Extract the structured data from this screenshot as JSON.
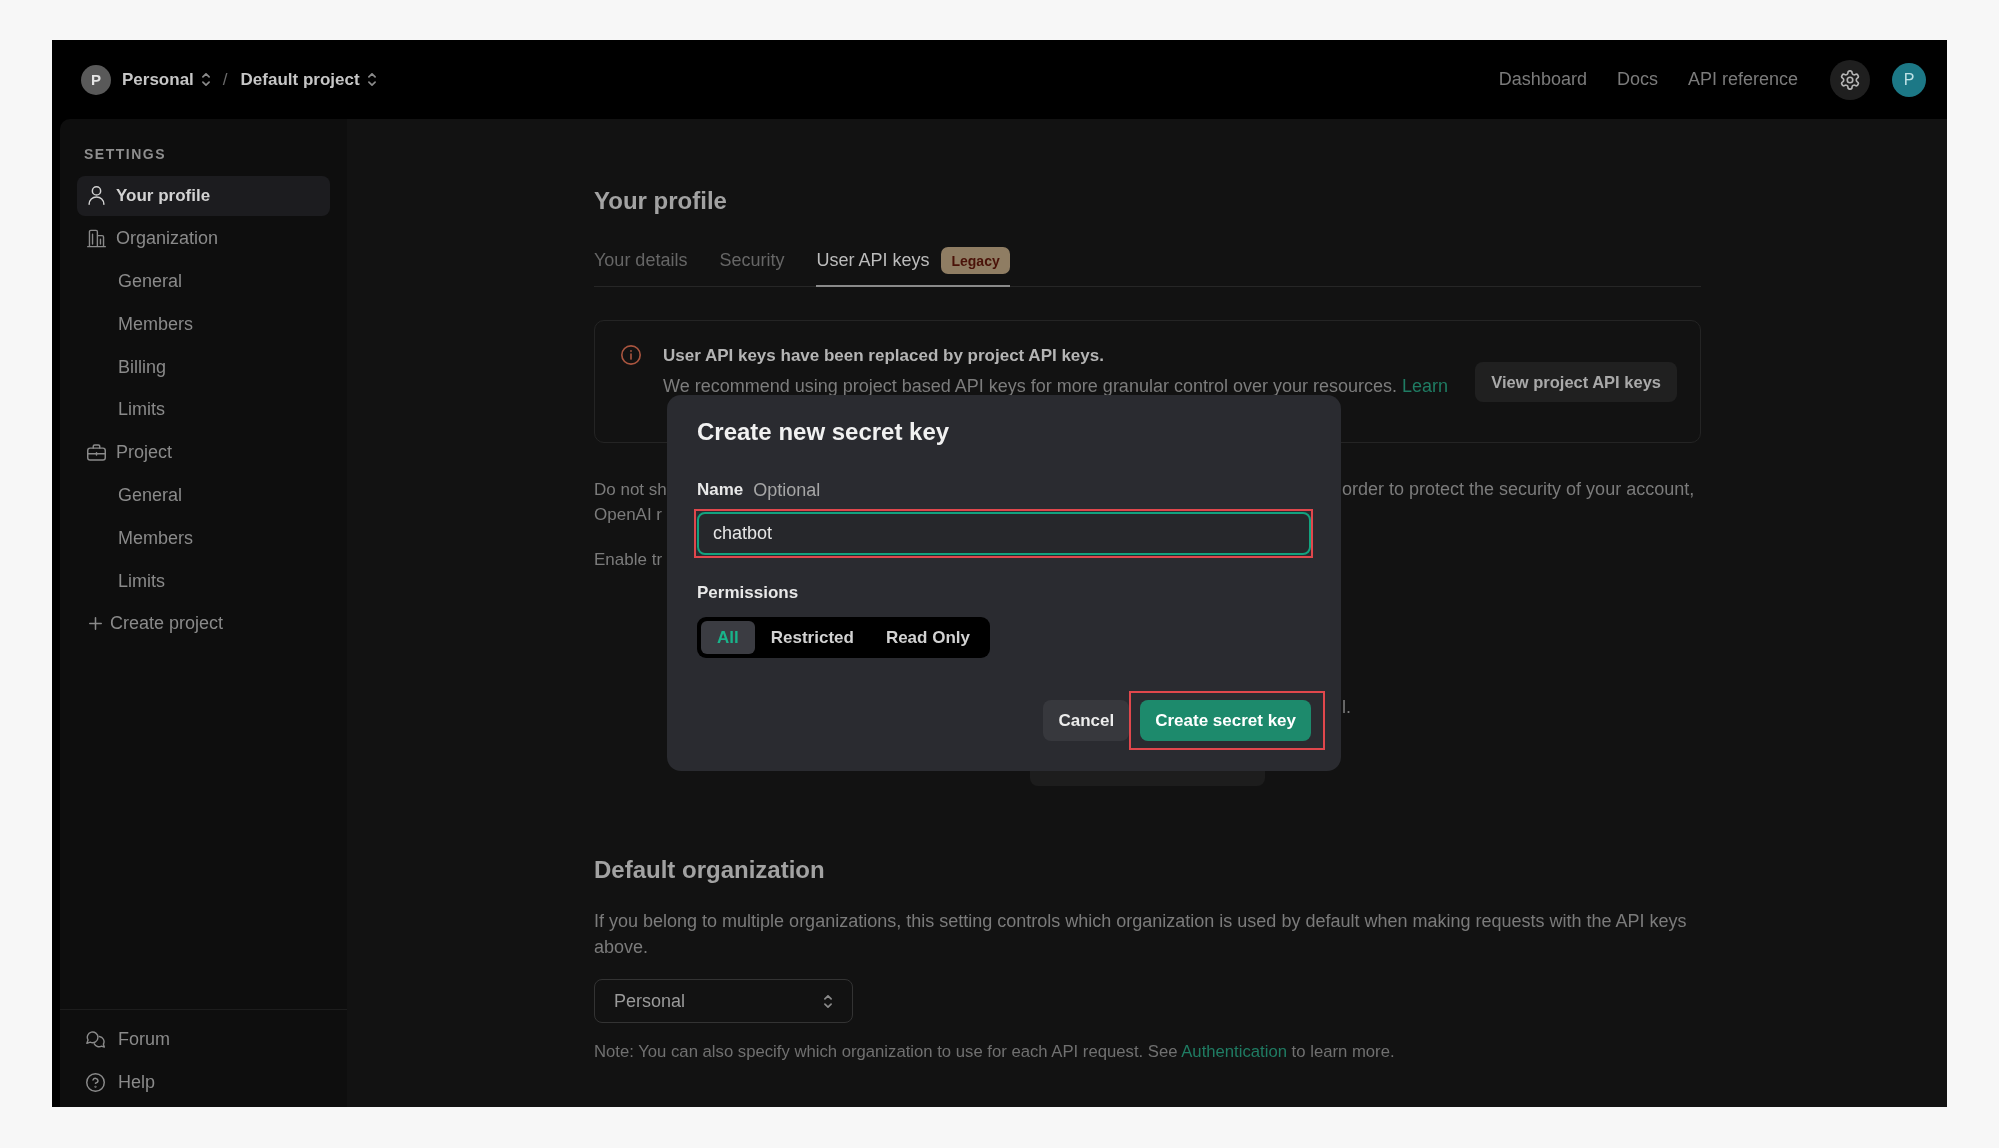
{
  "top_bar": {
    "breadcrumbs": [
      {
        "avatar": "P",
        "label": "Personal"
      },
      {
        "label": "Default project"
      }
    ],
    "separator": "/",
    "links": [
      "Dashboard",
      "Docs",
      "API reference"
    ],
    "user_avatar": "P"
  },
  "sidebar": {
    "heading": "SETTINGS",
    "sections": [
      {
        "label": "Your profile",
        "selected": true
      },
      {
        "label": "Organization",
        "selected": false,
        "children": [
          {
            "label": "General",
            "selected": false
          },
          {
            "label": "Members",
            "selected": false
          },
          {
            "label": "Billing",
            "selected": false
          },
          {
            "label": "Limits",
            "selected": false
          }
        ]
      },
      {
        "label": "Project",
        "selected": false,
        "children": [
          {
            "label": "General",
            "selected": false
          },
          {
            "label": "Members",
            "selected": false
          },
          {
            "label": "Limits",
            "selected": false
          }
        ]
      }
    ],
    "action": "Create project",
    "footer": [
      "Forum",
      "Help"
    ]
  },
  "profile": {
    "title": "Your profile",
    "tabs": [
      {
        "label": "Your details",
        "selected": false
      },
      {
        "label": "Security",
        "selected": false
      },
      {
        "label": "User API keys",
        "selected": true,
        "badge": "Legacy"
      }
    ],
    "notice": {
      "title": "User API keys have been replaced by project API keys.",
      "text": "We recommend using project based API keys for more granular control over your resources. ",
      "link": "Learn",
      "button": "View project API keys"
    },
    "behind_dialog": [
      {
        "left": "Do not sh",
        "right": "order to protect the security of your account,"
      },
      {
        "left": "OpenAI r"
      },
      {
        "left": "Enable tr"
      },
      {
        "right": "l."
      }
    ]
  },
  "default_organization": {
    "title": "Default organization",
    "description": "If you belong to multiple organizations, this setting controls which organization is used by default when making requests with the API keys above.",
    "select": {
      "value": "Personal"
    },
    "note": {
      "before": "Note: You can also specify which organization to use for each API request. See ",
      "link": "Authentication",
      "after": " to learn more."
    }
  },
  "dialog": {
    "title": "Create new secret key",
    "name_field": {
      "label": "Name",
      "qualifier": "Optional",
      "value": "chatbot",
      "focused": true,
      "highlighted": true
    },
    "permissions": {
      "label": "Permissions",
      "options": [
        {
          "label": "All",
          "selected": true
        },
        {
          "label": "Restricted",
          "selected": false
        },
        {
          "label": "Read Only",
          "selected": false
        }
      ]
    },
    "buttons": [
      {
        "label": "Cancel",
        "kind": "secondary"
      },
      {
        "label": "Create secret key",
        "kind": "primary",
        "highlighted": true
      }
    ]
  }
}
